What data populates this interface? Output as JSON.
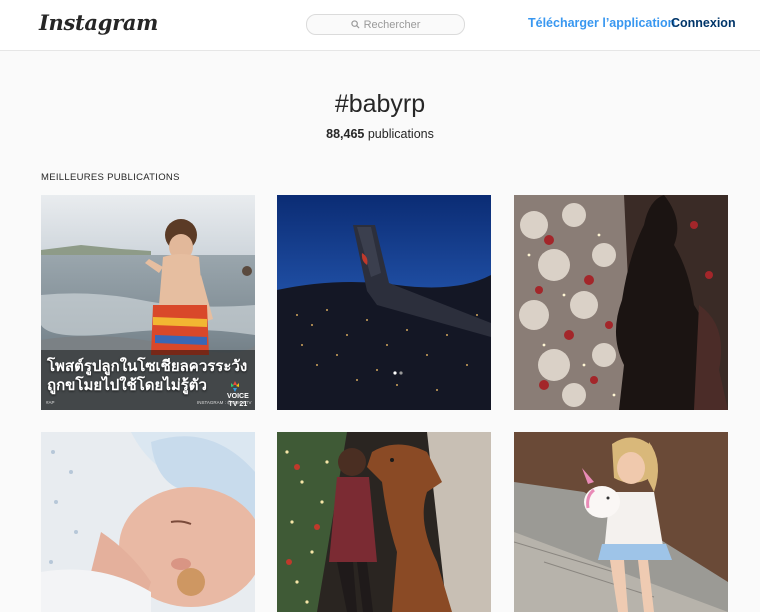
{
  "header": {
    "logo_text": "Instagram",
    "search_placeholder": "Rechercher",
    "download_link": "Télécharger l’application",
    "login_link": "Connexion"
  },
  "hashtag": {
    "title": "#babyrp",
    "count_number": "88,465",
    "count_label": "publications"
  },
  "section": {
    "title": "MEILLEURES PUBLICATIONS"
  },
  "posts": [
    {
      "overlay_line1": "โพสต์รูปลูกในโซเชียลควรระวัง",
      "overlay_line2": "ถูกขโมยไปใช้โดยไม่รู้ตัว",
      "brand": "VOICE",
      "brand_sub": "TV 21",
      "credit": "INSTAGRAM : @VOICETV",
      "source": "#AP"
    },
    {},
    {},
    {},
    {},
    {}
  ],
  "colors": {
    "link_blue": "#3897f0",
    "login_navy": "#003569",
    "text": "#262626",
    "background": "#fafafa"
  }
}
